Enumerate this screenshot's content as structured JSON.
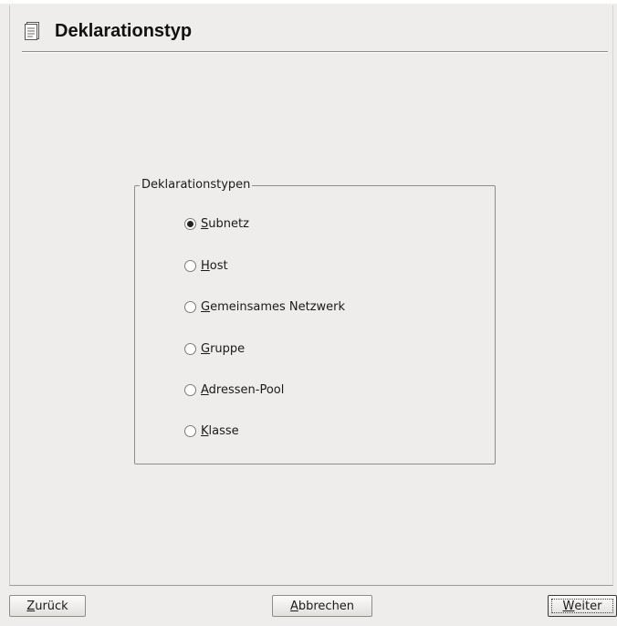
{
  "header": {
    "title": "Deklarationstyp",
    "icon": "document-icon"
  },
  "group": {
    "legend": "Deklarationstypen",
    "options": [
      {
        "accel": "S",
        "rest": "ubnetz",
        "checked": true
      },
      {
        "accel": "H",
        "rest": "ost",
        "checked": false
      },
      {
        "accel": "G",
        "rest": "emeinsames Netzwerk",
        "checked": false
      },
      {
        "accel": "G",
        "rest": "ruppe",
        "checked": false
      },
      {
        "accel": "A",
        "rest": "dressen-Pool",
        "checked": false
      },
      {
        "accel": "K",
        "rest": "lasse",
        "checked": false
      }
    ]
  },
  "buttons": {
    "back": {
      "accel": "Z",
      "rest": "urück"
    },
    "cancel": {
      "accel": "A",
      "rest": "bbrechen"
    },
    "next": {
      "accel": "W",
      "rest": "eiter"
    }
  },
  "colors": {
    "background": "#efedeb",
    "text": "#1a1a1a",
    "border": "#8e8c89"
  }
}
